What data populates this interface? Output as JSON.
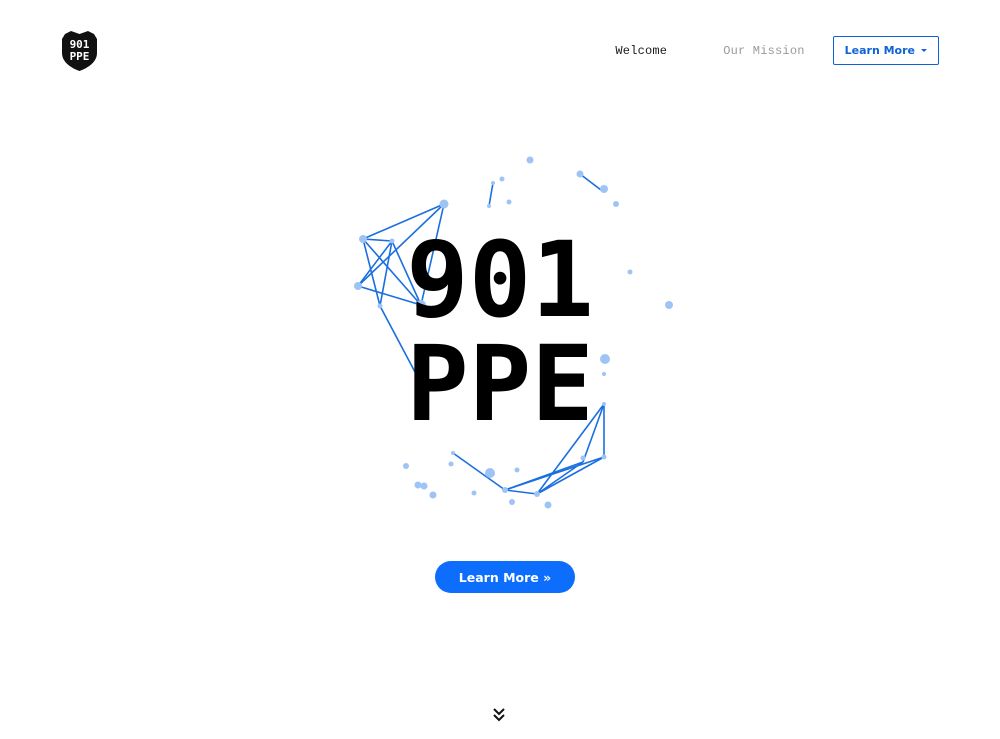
{
  "header": {
    "logo": {
      "icon": "shield-logo-icon",
      "line1": "901",
      "line2": "PPE"
    },
    "nav": {
      "welcome": "Welcome",
      "mission": "Our Mission",
      "dropdown": "Learn More"
    }
  },
  "hero": {
    "title_line1": "901",
    "title_line2": "PPE",
    "cta_label": "Learn More »",
    "scroll_icon": "double-chevron-down-icon"
  },
  "colors": {
    "accent": "#0d6efd",
    "network_line": "#1a6fe0",
    "network_node": "#9ec4f5",
    "text": "#000000"
  }
}
